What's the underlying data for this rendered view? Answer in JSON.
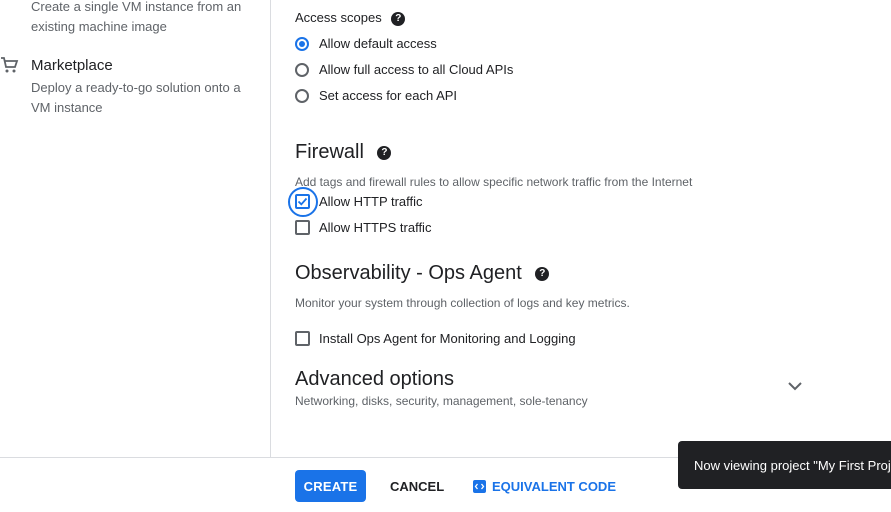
{
  "left_nav": {
    "machine_image_desc": "Create a single VM instance from an existing machine image",
    "marketplace": {
      "title": "Marketplace",
      "desc": "Deploy a ready-to-go solution onto a VM instance"
    }
  },
  "access_scopes": {
    "label": "Access scopes",
    "options": [
      {
        "label": "Allow default access",
        "selected": true
      },
      {
        "label": "Allow full access to all Cloud APIs",
        "selected": false
      },
      {
        "label": "Set access for each API",
        "selected": false
      }
    ]
  },
  "firewall": {
    "title": "Firewall",
    "desc": "Add tags and firewall rules to allow specific network traffic from the Internet",
    "options": [
      {
        "label": "Allow HTTP traffic",
        "checked": true
      },
      {
        "label": "Allow HTTPS traffic",
        "checked": false
      }
    ]
  },
  "observability": {
    "title": "Observability - Ops Agent",
    "desc": "Monitor your system through collection of logs and key metrics.",
    "option": {
      "label": "Install Ops Agent for Monitoring and Logging",
      "checked": false
    }
  },
  "advanced": {
    "title": "Advanced options",
    "desc": "Networking, disks, security, management, sole-tenancy"
  },
  "footer": {
    "create": "CREATE",
    "cancel": "CANCEL",
    "equivalent_code": "EQUIVALENT CODE"
  },
  "toast": {
    "text": "Now viewing project \"My First Proj"
  },
  "colors": {
    "accent": "#1a73e8",
    "toast_bg": "#202124"
  },
  "icons": [
    "help-icon",
    "marketplace-cart-icon",
    "chevron-down-icon",
    "code-icon",
    "checkmark-icon"
  ]
}
